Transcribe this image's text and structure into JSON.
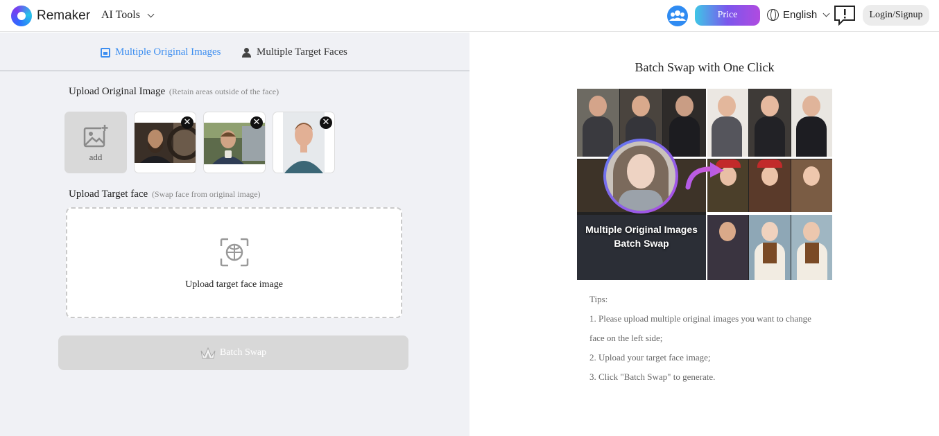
{
  "header": {
    "brand": "Remaker",
    "ai_tools": "AI Tools",
    "price": "Price",
    "language": "English",
    "login": "Login/Signup"
  },
  "tabs": [
    {
      "label": "Multiple Original Images",
      "active": true
    },
    {
      "label": "Multiple Target Faces",
      "active": false
    }
  ],
  "upload_original": {
    "title": "Upload Original Image",
    "hint": "(Retain areas outside of the face)",
    "add_label": "add",
    "thumbnails": [
      "man-with-beard",
      "man-with-mug",
      "man-portrait"
    ]
  },
  "upload_target": {
    "title": "Upload Target face",
    "hint": "(Swap face from original image)",
    "drop_label": "Upload target face image"
  },
  "batch_button": "Batch Swap",
  "preview": {
    "title": "Batch Swap with One Click",
    "overlay_line1": "Multiple Original Images",
    "overlay_line2": "Batch Swap"
  },
  "tips": {
    "heading": "Tips:",
    "items": [
      "1. Please upload multiple original images you want to change face on the left side;",
      "2. Upload your target face image;",
      "3. Click \"Batch Swap\" to generate."
    ]
  },
  "colors": {
    "accent": "#3d8ef0",
    "price_gradient": [
      "#3fc6e6",
      "#7b56ec",
      "#b04be0"
    ],
    "panel_bg": "#f0f1f5",
    "disabled_button": "#d8d8d8"
  }
}
